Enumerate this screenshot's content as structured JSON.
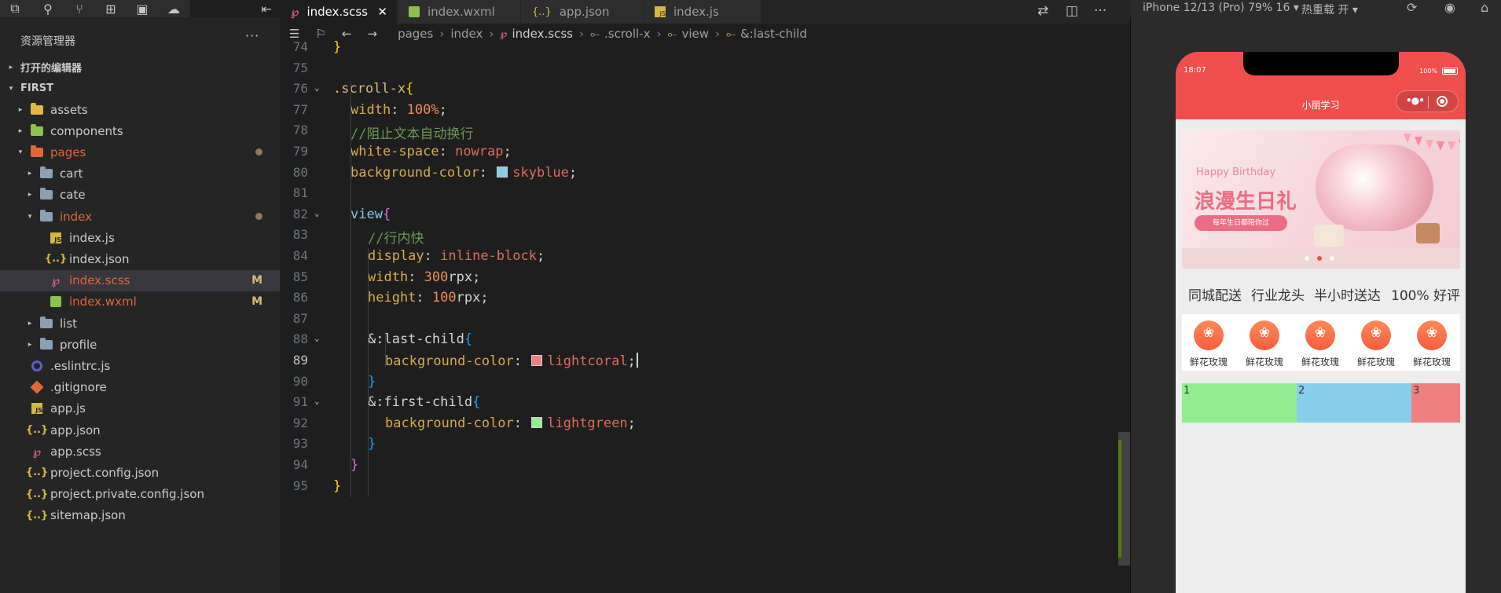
{
  "activity": {
    "icons": [
      "explorer-icon",
      "search-icon",
      "source-control-icon",
      "extensions-icon",
      "debug-icon",
      "docker-icon",
      "collapse-icon"
    ]
  },
  "sidebar": {
    "title": "资源管理器",
    "more": "···",
    "open_editors": "打开的编辑器",
    "project": "FIRST",
    "tree": [
      {
        "label": "assets",
        "kind": "folder-assets",
        "depth": 1,
        "chev": "▸"
      },
      {
        "label": "components",
        "kind": "folder-comp",
        "depth": 1,
        "chev": "▸"
      },
      {
        "label": "pages",
        "kind": "folder-pages",
        "depth": 1,
        "chev": "▾",
        "dot": true,
        "color": "#e2663a"
      },
      {
        "label": "cart",
        "kind": "folder",
        "depth": 2,
        "chev": "▸"
      },
      {
        "label": "cate",
        "kind": "folder",
        "depth": 2,
        "chev": "▸"
      },
      {
        "label": "index",
        "kind": "folder",
        "depth": 2,
        "chev": "▾",
        "dot": true,
        "color": "#e2663a"
      },
      {
        "label": "index.js",
        "kind": "js",
        "depth": 3
      },
      {
        "label": "index.json",
        "kind": "json",
        "depth": 3
      },
      {
        "label": "index.scss",
        "kind": "scss",
        "depth": 3,
        "mark": "M",
        "color": "#e2663a",
        "selected": true
      },
      {
        "label": "index.wxml",
        "kind": "wxml",
        "depth": 3,
        "mark": "M",
        "color": "#e2663a"
      },
      {
        "label": "list",
        "kind": "folder",
        "depth": 2,
        "chev": "▸"
      },
      {
        "label": "profile",
        "kind": "folder",
        "depth": 2,
        "chev": "▸"
      },
      {
        "label": ".eslintrc.js",
        "kind": "eslint",
        "depth": 1
      },
      {
        "label": ".gitignore",
        "kind": "git",
        "depth": 1
      },
      {
        "label": "app.js",
        "kind": "js",
        "depth": 1
      },
      {
        "label": "app.json",
        "kind": "json",
        "depth": 1
      },
      {
        "label": "app.scss",
        "kind": "scss",
        "depth": 1
      },
      {
        "label": "project.config.json",
        "kind": "json",
        "depth": 1
      },
      {
        "label": "project.private.config.json",
        "kind": "json",
        "depth": 1
      },
      {
        "label": "sitemap.json",
        "kind": "json",
        "depth": 1
      }
    ]
  },
  "tabs": [
    {
      "label": "index.scss",
      "kind": "scss",
      "active": true,
      "close": "✕"
    },
    {
      "label": "index.wxml",
      "kind": "wxml",
      "active": false
    },
    {
      "label": "app.json",
      "kind": "json",
      "active": false
    },
    {
      "label": "index.js",
      "kind": "js",
      "active": false
    }
  ],
  "breadcrumb": [
    "pages",
    "index",
    "index.scss",
    ".scroll-x",
    "view",
    "&:last-child"
  ],
  "editor": {
    "current_line": 89,
    "lines": [
      {
        "n": 74,
        "code": "}"
      },
      {
        "n": 75,
        "code": ""
      },
      {
        "n": 76,
        "code": ".scroll-x{"
      },
      {
        "n": 77,
        "code": "width: 100%;"
      },
      {
        "n": 78,
        "code": "//阻止文本自动换行"
      },
      {
        "n": 79,
        "code": "white-space: nowrap;"
      },
      {
        "n": 80,
        "code": "background-color: skyblue;"
      },
      {
        "n": 81,
        "code": ""
      },
      {
        "n": 82,
        "code": "view{"
      },
      {
        "n": 83,
        "code": "//行内快"
      },
      {
        "n": 84,
        "code": "display: inline-block;"
      },
      {
        "n": 85,
        "code": "width: 300rpx;"
      },
      {
        "n": 86,
        "code": "height: 100rpx;"
      },
      {
        "n": 87,
        "code": ""
      },
      {
        "n": 88,
        "code": "&:last-child{"
      },
      {
        "n": 89,
        "code": "background-color: lightcoral;"
      },
      {
        "n": 90,
        "code": "}"
      },
      {
        "n": 91,
        "code": "&:first-child{"
      },
      {
        "n": 92,
        "code": "background-color: lightgreen;"
      },
      {
        "n": 93,
        "code": "}"
      },
      {
        "n": 94,
        "code": "}"
      },
      {
        "n": 95,
        "code": "}"
      }
    ],
    "colors": {
      "skyblue": "#87ceeb",
      "lightcoral": "#f08080",
      "lightgreen": "#90ee90"
    }
  },
  "simulator": {
    "device": "iPhone 12/13 (Pro) 79% 16 ▾",
    "hot_reload": "热重载 开 ▾",
    "time": "18:07",
    "battery": "100%",
    "nav_title": "小丽学习",
    "banner": {
      "happy": "Happy Birthday",
      "title": "浪漫生日礼",
      "pill": "每年生日都陪你过"
    },
    "slogans": [
      "同城配送",
      "行业龙头",
      "半小时送达",
      "100% 好评"
    ],
    "categories": [
      "鲜花玫瑰",
      "鲜花玫瑰",
      "鲜花玫瑰",
      "鲜花玫瑰",
      "鲜花玫瑰"
    ],
    "scroll_items": [
      {
        "label": "1",
        "color": "#90ee90"
      },
      {
        "label": "2",
        "color": "#87ceeb"
      },
      {
        "label": "3",
        "color": "#f08080"
      }
    ]
  }
}
